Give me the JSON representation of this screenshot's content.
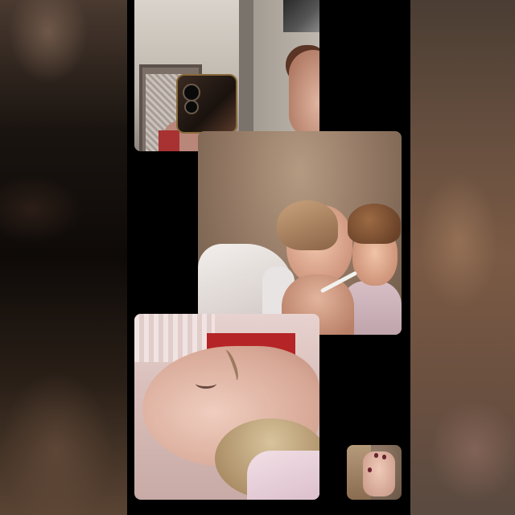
{
  "call": {
    "participants": [
      {
        "id": "participant-1",
        "video": "mirror-selfie"
      },
      {
        "id": "participant-2",
        "video": "two-people"
      },
      {
        "id": "participant-3",
        "video": "lying-down"
      },
      {
        "id": "self",
        "video": "self-view"
      }
    ]
  },
  "colors": {
    "background": "#000000",
    "accent_red": "#b52426"
  }
}
